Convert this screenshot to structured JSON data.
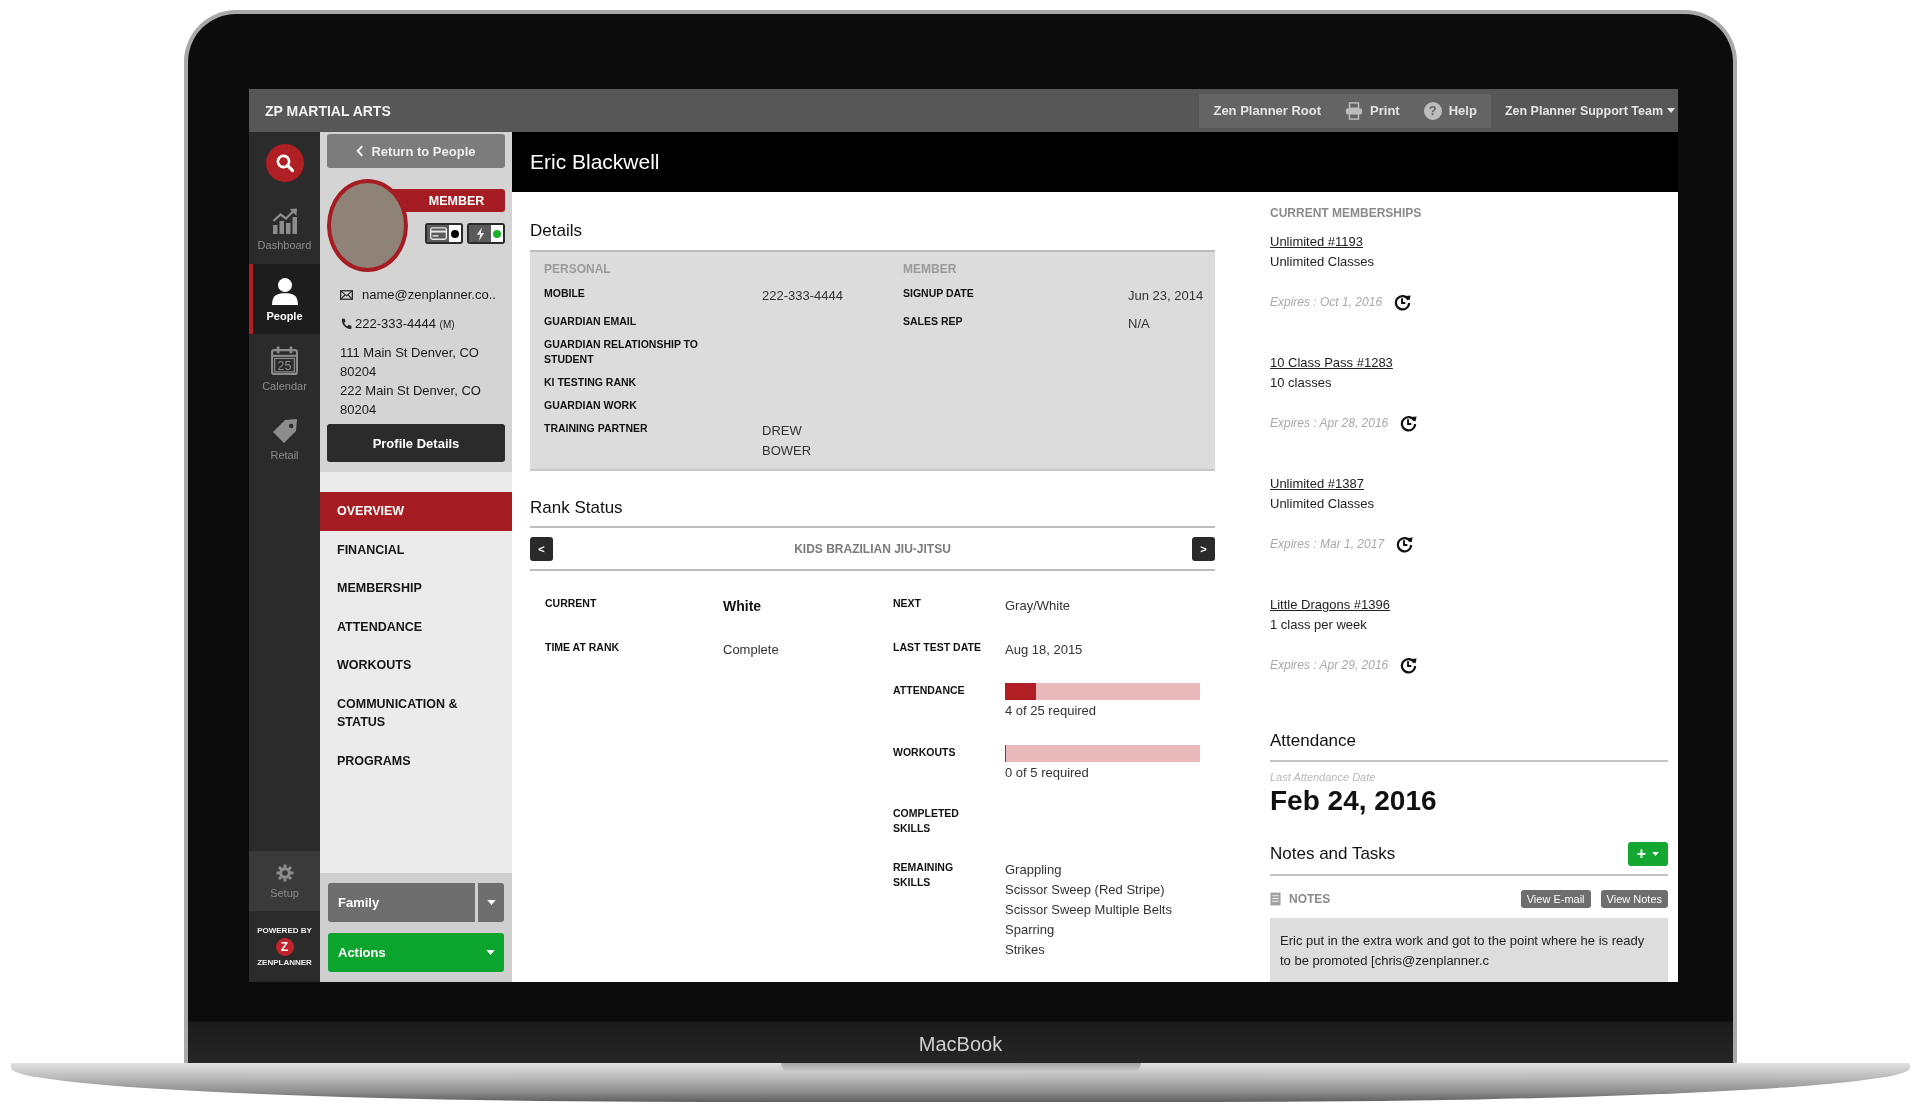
{
  "device": {
    "label": "MacBook"
  },
  "top_bar": {
    "brand": "ZP MARTIAL ARTS",
    "links": [
      {
        "kind": "plain",
        "label": "Zen Planner Root"
      },
      {
        "kind": "print",
        "label": "Print"
      },
      {
        "kind": "help",
        "icon_text": "?",
        "label": "Help"
      }
    ],
    "user_menu": "Zen Planner Support Team"
  },
  "rail": {
    "items": [
      {
        "kind": "dashboard",
        "label": "Dashboard",
        "selected": false
      },
      {
        "kind": "people",
        "label": "People",
        "selected": true
      },
      {
        "kind": "calendar",
        "label": "Calendar",
        "icon_text": "25",
        "selected": false
      },
      {
        "kind": "retail",
        "label": "Retail",
        "selected": false
      }
    ],
    "setup": "Setup",
    "powered_by": {
      "caption": "POWERED BY",
      "logo_letter": "Z",
      "brand": "ZENPLANNER"
    }
  },
  "profile": {
    "return_button": "Return to People",
    "badge": "MEMBER",
    "status_indicators": [
      {
        "kind": "card",
        "color": "#000000"
      },
      {
        "kind": "bolt",
        "color": "#1fb02a"
      }
    ],
    "email": "name@zenplanner.co..",
    "phone": "222-333-4444",
    "phone_type": "(M)",
    "addresses": [
      "111 Main St Denver, CO 80204",
      "222 Main St Denver, CO 80204"
    ],
    "details_button": "Profile Details",
    "nav": [
      {
        "label": "OVERVIEW",
        "selected": true
      },
      {
        "label": "FINANCIAL",
        "selected": false
      },
      {
        "label": "MEMBERSHIP",
        "selected": false
      },
      {
        "label": "ATTENDANCE",
        "selected": false
      },
      {
        "label": "WORKOUTS",
        "selected": false
      },
      {
        "label": "COMMUNICATION & STATUS",
        "selected": false
      },
      {
        "label": "PROGRAMS",
        "selected": false
      }
    ],
    "family_select": "Family",
    "actions_button": "Actions"
  },
  "person": {
    "name": "Eric Blackwell"
  },
  "details": {
    "title": "Details",
    "sections": [
      {
        "heading": "PERSONAL",
        "fields": [
          {
            "label": "MOBILE",
            "value": "222-333-4444"
          },
          {
            "label": "GUARDIAN EMAIL"
          },
          {
            "label": "GUARDIAN RELATIONSHIP TO STUDENT"
          },
          {
            "label": "KI TESTING RANK"
          },
          {
            "label": "GUARDIAN WORK"
          },
          {
            "label": "TRAINING PARTNER",
            "value": "DREW\nBOWER"
          }
        ]
      },
      {
        "heading": "MEMBER",
        "fields": [
          {
            "label": "SIGNUP DATE",
            "value": "Jun 23, 2014"
          },
          {
            "label": "SALES REP",
            "value": "N/A"
          }
        ]
      }
    ]
  },
  "rank_status": {
    "title": "Rank Status",
    "prev_button": "<",
    "program": "KIDS BRAZILIAN JIU-JITSU",
    "next_button": ">",
    "left_fields": [
      {
        "label": "CURRENT",
        "value": "White",
        "bold": true
      },
      {
        "label": "TIME AT RANK",
        "value": "Complete",
        "bold": false
      }
    ],
    "right_fields": [
      {
        "kind": "text",
        "label": "NEXT",
        "value": "Gray/White"
      },
      {
        "kind": "text",
        "label": "LAST TEST DATE",
        "value": "Aug 18, 2015"
      },
      {
        "kind": "progress",
        "label": "ATTENDANCE",
        "level": 0.16,
        "caption": "4 of 25 required"
      },
      {
        "kind": "progress",
        "label": "WORKOUTS",
        "level": 0,
        "caption": "0 of 5 required"
      },
      {
        "kind": "text",
        "label": "COMPLETED SKILLS"
      },
      {
        "kind": "list",
        "label": "REMAINING SKILLS",
        "items": [
          "Grappling",
          "Scissor Sweep (Red Stripe)",
          "Scissor Sweep Multiple Belts",
          "Sparring",
          "Strikes"
        ]
      }
    ]
  },
  "memberships": {
    "heading": "CURRENT MEMBERSHIPS",
    "items": [
      {
        "name": "Unlimited #1193",
        "description": "Unlimited Classes",
        "expires": "Expires : Oct 1, 2016"
      },
      {
        "name": "10 Class Pass #1283",
        "description": "10 classes",
        "expires": "Expires : Apr 28, 2016"
      },
      {
        "name": "Unlimited #1387",
        "description": "Unlimited Classes",
        "expires": "Expires : Mar 1, 2017"
      },
      {
        "name": "Little Dragons #1396",
        "description": "1 class per week",
        "expires": "Expires : Apr 29, 2016"
      }
    ]
  },
  "attendance": {
    "title": "Attendance",
    "caption": "Last Attendance Date",
    "date": "Feb 24, 2016"
  },
  "notes": {
    "title": "Notes and Tasks",
    "add_button": "+",
    "section_label": "NOTES",
    "buttons": [
      "View E-mail",
      "View Notes"
    ],
    "note": "Eric put in the extra work and got to the point where he is ready to be promoted [chris@zenplanner.c"
  }
}
